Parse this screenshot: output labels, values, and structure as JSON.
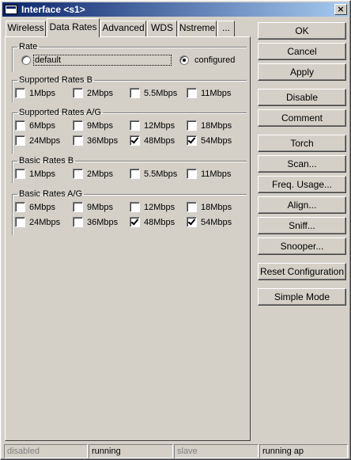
{
  "window": {
    "title": "Interface <s1>",
    "close_label": "×"
  },
  "tabs": [
    {
      "label": "Wireless",
      "active": false
    },
    {
      "label": "Data Rates",
      "active": true
    },
    {
      "label": "Advanced",
      "active": false
    },
    {
      "label": "WDS",
      "active": false
    },
    {
      "label": "Nstreme",
      "active": false
    },
    {
      "label": "...",
      "active": false
    }
  ],
  "rate": {
    "legend": "Rate",
    "options": [
      {
        "label": "default",
        "selected": false
      },
      {
        "label": "configured",
        "selected": true
      }
    ]
  },
  "groups": [
    {
      "legend": "Supported Rates B",
      "items": [
        {
          "label": "1Mbps",
          "checked": false
        },
        {
          "label": "2Mbps",
          "checked": false
        },
        {
          "label": "5.5Mbps",
          "checked": false
        },
        {
          "label": "11Mbps",
          "checked": false
        }
      ]
    },
    {
      "legend": "Supported Rates A/G",
      "items": [
        {
          "label": "6Mbps",
          "checked": false
        },
        {
          "label": "9Mbps",
          "checked": false
        },
        {
          "label": "12Mbps",
          "checked": false
        },
        {
          "label": "18Mbps",
          "checked": false
        },
        {
          "label": "24Mbps",
          "checked": false
        },
        {
          "label": "36Mbps",
          "checked": false
        },
        {
          "label": "48Mbps",
          "checked": true
        },
        {
          "label": "54Mbps",
          "checked": true
        }
      ]
    },
    {
      "legend": "Basic Rates B",
      "items": [
        {
          "label": "1Mbps",
          "checked": false
        },
        {
          "label": "2Mbps",
          "checked": false
        },
        {
          "label": "5.5Mbps",
          "checked": false
        },
        {
          "label": "11Mbps",
          "checked": false
        }
      ]
    },
    {
      "legend": "Basic Rates A/G",
      "items": [
        {
          "label": "6Mbps",
          "checked": false
        },
        {
          "label": "9Mbps",
          "checked": false
        },
        {
          "label": "12Mbps",
          "checked": false
        },
        {
          "label": "18Mbps",
          "checked": false
        },
        {
          "label": "24Mbps",
          "checked": false
        },
        {
          "label": "36Mbps",
          "checked": false
        },
        {
          "label": "48Mbps",
          "checked": true
        },
        {
          "label": "54Mbps",
          "checked": true
        }
      ]
    }
  ],
  "buttons": [
    {
      "label": "OK"
    },
    {
      "label": "Cancel"
    },
    {
      "label": "Apply"
    },
    {
      "label": "Disable"
    },
    {
      "label": "Comment"
    },
    {
      "label": "Torch"
    },
    {
      "label": "Scan..."
    },
    {
      "label": "Freq. Usage..."
    },
    {
      "label": "Align..."
    },
    {
      "label": "Sniff..."
    },
    {
      "label": "Snooper..."
    },
    {
      "label": "Reset Configuration"
    },
    {
      "label": "Simple Mode"
    }
  ],
  "status": [
    {
      "text": "disabled",
      "dim": true
    },
    {
      "text": "running",
      "dim": false
    },
    {
      "text": "slave",
      "dim": true
    },
    {
      "text": "running ap",
      "dim": false
    }
  ]
}
